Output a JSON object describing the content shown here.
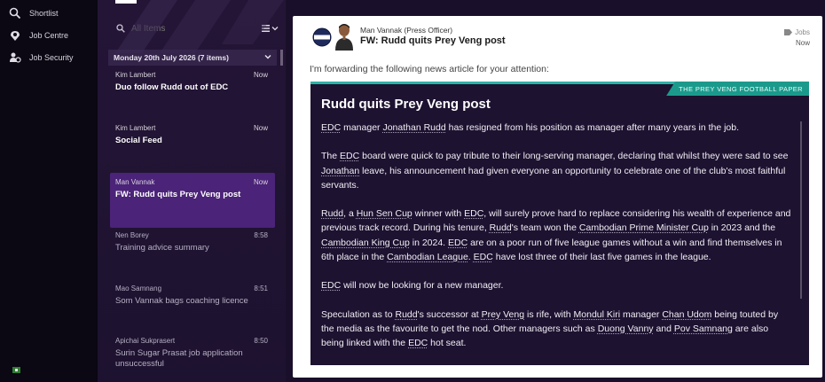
{
  "nav": {
    "items": [
      {
        "label": "Shortlist",
        "icon": "search-icon"
      },
      {
        "label": "Job Centre",
        "icon": "job-centre-icon"
      },
      {
        "label": "Job Security",
        "icon": "job-security-icon"
      }
    ]
  },
  "inbox": {
    "search_placeholder": "All Items",
    "group_header": "Monday 20th July 2026 (7 items)",
    "messages": [
      {
        "sender": "Kim Lambert",
        "time": "Now",
        "subject": "Duo follow Rudd out of EDC",
        "read": false,
        "selected": false
      },
      {
        "sender": "Kim Lambert",
        "time": "Now",
        "subject": "Social Feed",
        "read": false,
        "selected": false
      },
      {
        "sender": "Man Vannak",
        "time": "Now",
        "subject": "FW: Rudd quits Prey Veng post",
        "read": false,
        "selected": true
      },
      {
        "sender": "Nen Borey",
        "time": "8:58",
        "subject": "Training advice summary",
        "read": true,
        "selected": false
      },
      {
        "sender": "Mao Samnang",
        "time": "8:51",
        "subject": "Som Vannak bags coaching licence",
        "read": true,
        "selected": false
      },
      {
        "sender": "Apichai Sukprasert",
        "time": "8:50",
        "subject": "Surin Sugar Prasat job application unsuccessful",
        "read": true,
        "selected": false
      }
    ]
  },
  "detail": {
    "from": "Man Vannak (Press Officer)",
    "subject": "FW: Rudd quits Prey Veng post",
    "category": "Jobs",
    "time": "Now",
    "forward_note": "I'm forwarding the following news article for your attention:",
    "paper": "THE PREY VENG FOOTBALL PAPER",
    "headline": "Rudd quits Prey Veng post",
    "p1": [
      "",
      "EDC",
      " manager ",
      "Jonathan Rudd",
      " has resigned from his position as manager after many years in the job."
    ],
    "p2": [
      "The ",
      "EDC",
      " board were quick to pay tribute to their long-serving manager, declaring that whilst they were sad to see ",
      "Jonathan",
      " leave, his announcement had given everyone an opportunity to celebrate one of the club's most faithful servants."
    ],
    "p3": [
      "",
      "Rudd",
      ", a ",
      "Hun Sen Cup",
      " winner with ",
      "EDC",
      ", will surely prove hard to replace considering his wealth of experience and previous track record. During his tenure, ",
      "Rudd",
      "'s team won the ",
      "Cambodian Prime Minister Cup",
      " in 2023 and the ",
      "Cambodian King Cup",
      " in 2024. ",
      "EDC",
      " are on a poor run of five league games without a win and find themselves in 6th place in the ",
      "Cambodian League",
      ". ",
      "EDC",
      " have lost three of their last five games in the league."
    ],
    "p4": [
      "",
      "EDC",
      " will now be looking for a new manager."
    ],
    "p5": [
      "Speculation as to ",
      "Rudd",
      "'s successor at ",
      "Prey Veng",
      " is rife, with ",
      "Mondul Kiri",
      " manager ",
      "Chan Udom",
      " being touted by the media as the favourite to get the nod. Other managers such as ",
      "Duong Vanny",
      " and ",
      "Pov Samnang",
      " are also being linked with the ",
      "EDC",
      " hot seat."
    ]
  },
  "colors": {
    "accent_teal": "#2bb3a5",
    "selected_purple": "#4b2378",
    "panel_dark": "#1d1230"
  }
}
